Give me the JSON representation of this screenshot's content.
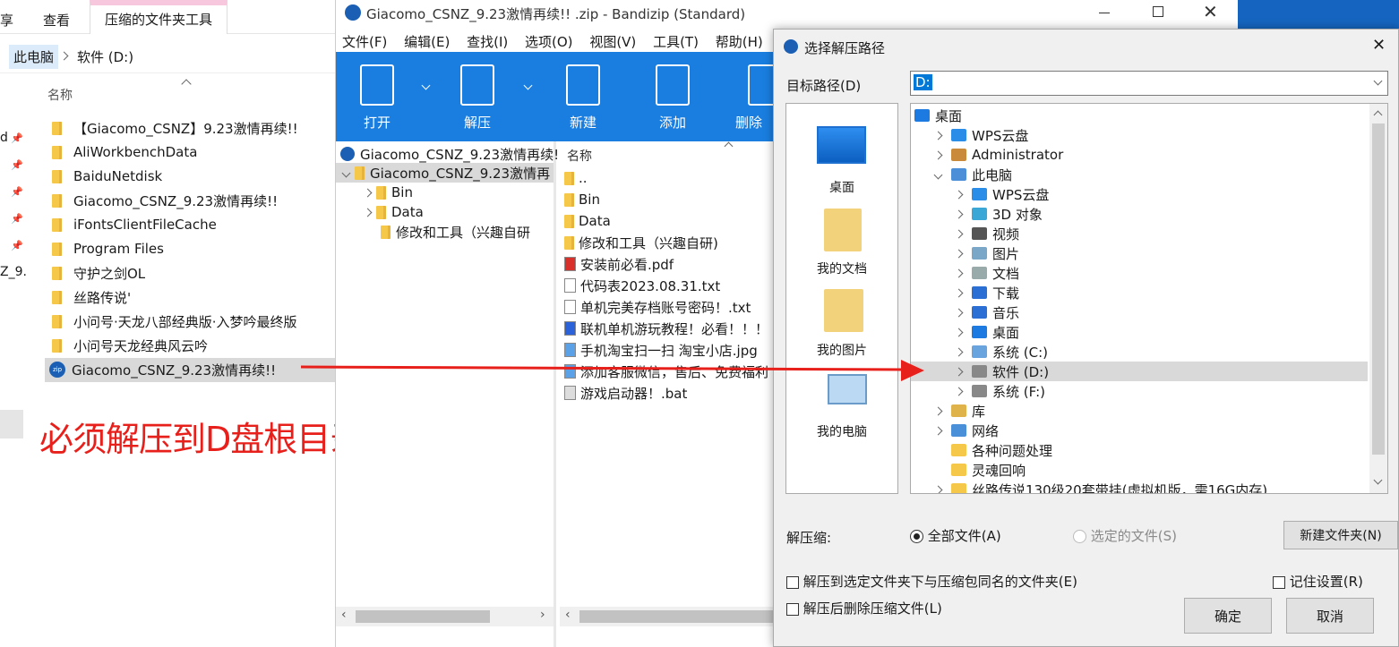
{
  "explorer": {
    "ribbon_tabs": [
      "享",
      "查看",
      "压缩的文件夹工具"
    ],
    "breadcrumb": [
      "此电脑",
      "软件 (D:)"
    ],
    "column_header": "名称",
    "left_nav_fragments": [
      "d",
      "Z_9."
    ],
    "items": [
      "【Giacomo_CSNZ】9.23激情再续!!",
      "AliWorkbenchData",
      "BaiduNetdisk",
      "Giacomo_CSNZ_9.23激情再续!!",
      "iFontsClientFileCache",
      "Program Files",
      "守护之剑OL",
      "丝路传说'",
      "小问号·天龙八部经典版·入梦吟最终版",
      "小问号天龙经典风云吟",
      "Giacomo_CSNZ_9.23激情再续!!"
    ]
  },
  "annotation": {
    "text": "必须解压到D盘根目录下",
    "color": "#e8201c"
  },
  "bandizip": {
    "title": "Giacomo_CSNZ_9.23激情再续!!  .zip - Bandizip (Standard)",
    "menu": [
      "文件(F)",
      "编辑(E)",
      "查找(I)",
      "选项(O)",
      "视图(V)",
      "工具(T)",
      "帮助(H)"
    ],
    "toolbar": [
      "打开",
      "解压",
      "新建",
      "添加",
      "删除"
    ],
    "accent": "#1a7ee0",
    "tree": {
      "root": "Giacomo_CSNZ_9.23激情再续!",
      "folder": "Giacomo_CSNZ_9.23激情再",
      "children": [
        "Bin",
        "Data",
        "修改和工具（兴趣自研"
      ]
    },
    "list_header": "名称",
    "list": [
      {
        "name": "..",
        "icon": "folder"
      },
      {
        "name": "Bin",
        "icon": "folder"
      },
      {
        "name": "Data",
        "icon": "folder"
      },
      {
        "name": "修改和工具（兴趣自研)",
        "icon": "folder"
      },
      {
        "name": "安装前必看.pdf",
        "icon": "pdf"
      },
      {
        "name": "代码表2023.08.31.txt",
        "icon": "txt"
      },
      {
        "name": "单机完美存档账号密码！.txt",
        "icon": "txt"
      },
      {
        "name": "联机单机游玩教程！必看！！！",
        "icon": "doc"
      },
      {
        "name": "手机淘宝扫一扫 淘宝小店.jpg",
        "icon": "jpg"
      },
      {
        "name": "添加客服微信，售后、免费福利",
        "icon": "jpg"
      },
      {
        "name": "游戏启动器！.bat",
        "icon": "bat"
      }
    ]
  },
  "dialog": {
    "title": "选择解压路径",
    "target_label": "目标路径(D)",
    "target_value": "D:",
    "quick": [
      "桌面",
      "我的文档",
      "我的图片",
      "我的电脑"
    ],
    "tree": [
      {
        "label": "桌面",
        "indent": 0,
        "expander": "",
        "icon": "desktop"
      },
      {
        "label": "WPS云盘",
        "indent": 1,
        "expander": "right",
        "icon": "cloud"
      },
      {
        "label": "Administrator",
        "indent": 1,
        "expander": "right",
        "icon": "user"
      },
      {
        "label": "此电脑",
        "indent": 1,
        "expander": "down",
        "icon": "pc"
      },
      {
        "label": "WPS云盘",
        "indent": 2,
        "expander": "right",
        "icon": "cloud"
      },
      {
        "label": "3D 对象",
        "indent": 2,
        "expander": "right",
        "icon": "cube"
      },
      {
        "label": "视频",
        "indent": 2,
        "expander": "right",
        "icon": "video"
      },
      {
        "label": "图片",
        "indent": 2,
        "expander": "right",
        "icon": "picture"
      },
      {
        "label": "文档",
        "indent": 2,
        "expander": "right",
        "icon": "doc"
      },
      {
        "label": "下载",
        "indent": 2,
        "expander": "right",
        "icon": "download"
      },
      {
        "label": "音乐",
        "indent": 2,
        "expander": "right",
        "icon": "music"
      },
      {
        "label": "桌面",
        "indent": 2,
        "expander": "right",
        "icon": "desktop"
      },
      {
        "label": "系统 (C:)",
        "indent": 2,
        "expander": "right",
        "icon": "drive-c"
      },
      {
        "label": "软件 (D:)",
        "indent": 2,
        "expander": "right",
        "icon": "drive",
        "selected": true
      },
      {
        "label": "系统 (F:)",
        "indent": 2,
        "expander": "right",
        "icon": "drive"
      },
      {
        "label": "库",
        "indent": 1,
        "expander": "right",
        "icon": "library"
      },
      {
        "label": "网络",
        "indent": 1,
        "expander": "right",
        "icon": "network"
      },
      {
        "label": "各种问题处理",
        "indent": 1,
        "expander": "",
        "icon": "folder"
      },
      {
        "label": "灵魂回响",
        "indent": 1,
        "expander": "",
        "icon": "folder"
      },
      {
        "label": "丝路传说130级20套带挂(虚拟机版，需16G内存)",
        "indent": 1,
        "expander": "right",
        "icon": "folder"
      }
    ],
    "extract_label": "解压缩:",
    "radio_all": "全部文件(A)",
    "radio_selected": "选定的文件(S)",
    "new_folder": "新建文件夹(N)",
    "check_subfolder": "解压到选定文件夹下与压缩包同名的文件夹(E)",
    "check_remember": "记住设置(R)",
    "check_delete": "解压后删除压缩文件(L)",
    "ok": "确定",
    "cancel": "取消"
  }
}
